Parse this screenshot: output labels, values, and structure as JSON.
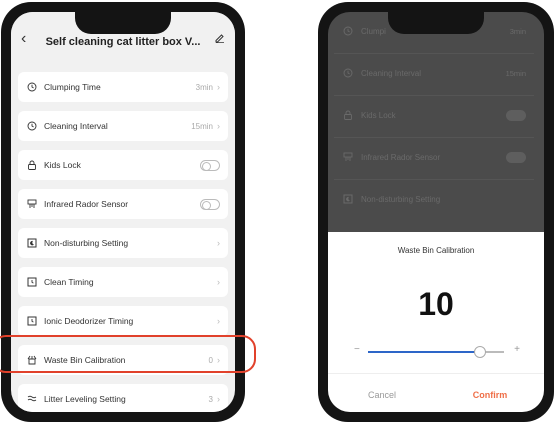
{
  "colors": {
    "accent": "#e1412b",
    "confirm": "#ef6f48",
    "slider": "#2d66c8"
  },
  "header": {
    "title": "Self cleaning cat litter box V...",
    "back_icon": "chevron-left-icon",
    "edit_icon": "pencil-icon"
  },
  "rows": [
    {
      "label": "Clumping Time",
      "value": "3min",
      "icon": "clock-icon",
      "control": "chevron"
    },
    {
      "label": "Cleaning Interval",
      "value": "15min",
      "icon": "clock-icon",
      "control": "chevron"
    },
    {
      "label": "Kids Lock",
      "value": "",
      "icon": "lock-icon",
      "control": "toggle"
    },
    {
      "label": "Infrared Rador Sensor",
      "value": "",
      "icon": "sensor-icon",
      "control": "toggle"
    },
    {
      "label": "Non-disturbing Setting",
      "value": "",
      "icon": "moon-icon",
      "control": "chevron"
    },
    {
      "label": "Clean Timing",
      "value": "",
      "icon": "alarm-icon",
      "control": "chevron"
    },
    {
      "label": "Ionic Deodorizer Timing",
      "value": "",
      "icon": "alarm-icon",
      "control": "chevron"
    },
    {
      "label": "Waste Bin Calibration",
      "value": "0",
      "icon": "bin-icon",
      "control": "chevron"
    },
    {
      "label": "Litter Leveling Setting",
      "value": "3",
      "icon": "level-icon",
      "control": "chevron"
    }
  ],
  "background_rows": [
    {
      "label": "Clumpi",
      "value": "3min"
    },
    {
      "label": "Cleaning Interval",
      "value": "15min"
    },
    {
      "label": "Kids Lock",
      "value": ""
    },
    {
      "label": "Infrared Rador Sensor",
      "value": ""
    },
    {
      "label": "Non-disturbing Setting",
      "value": ""
    }
  ],
  "dialog": {
    "title": "Waste Bin Calibration",
    "value": "10",
    "slider_fraction": 0.82,
    "minus": "−",
    "plus": "+",
    "cancel": "Cancel",
    "confirm": "Confirm"
  }
}
